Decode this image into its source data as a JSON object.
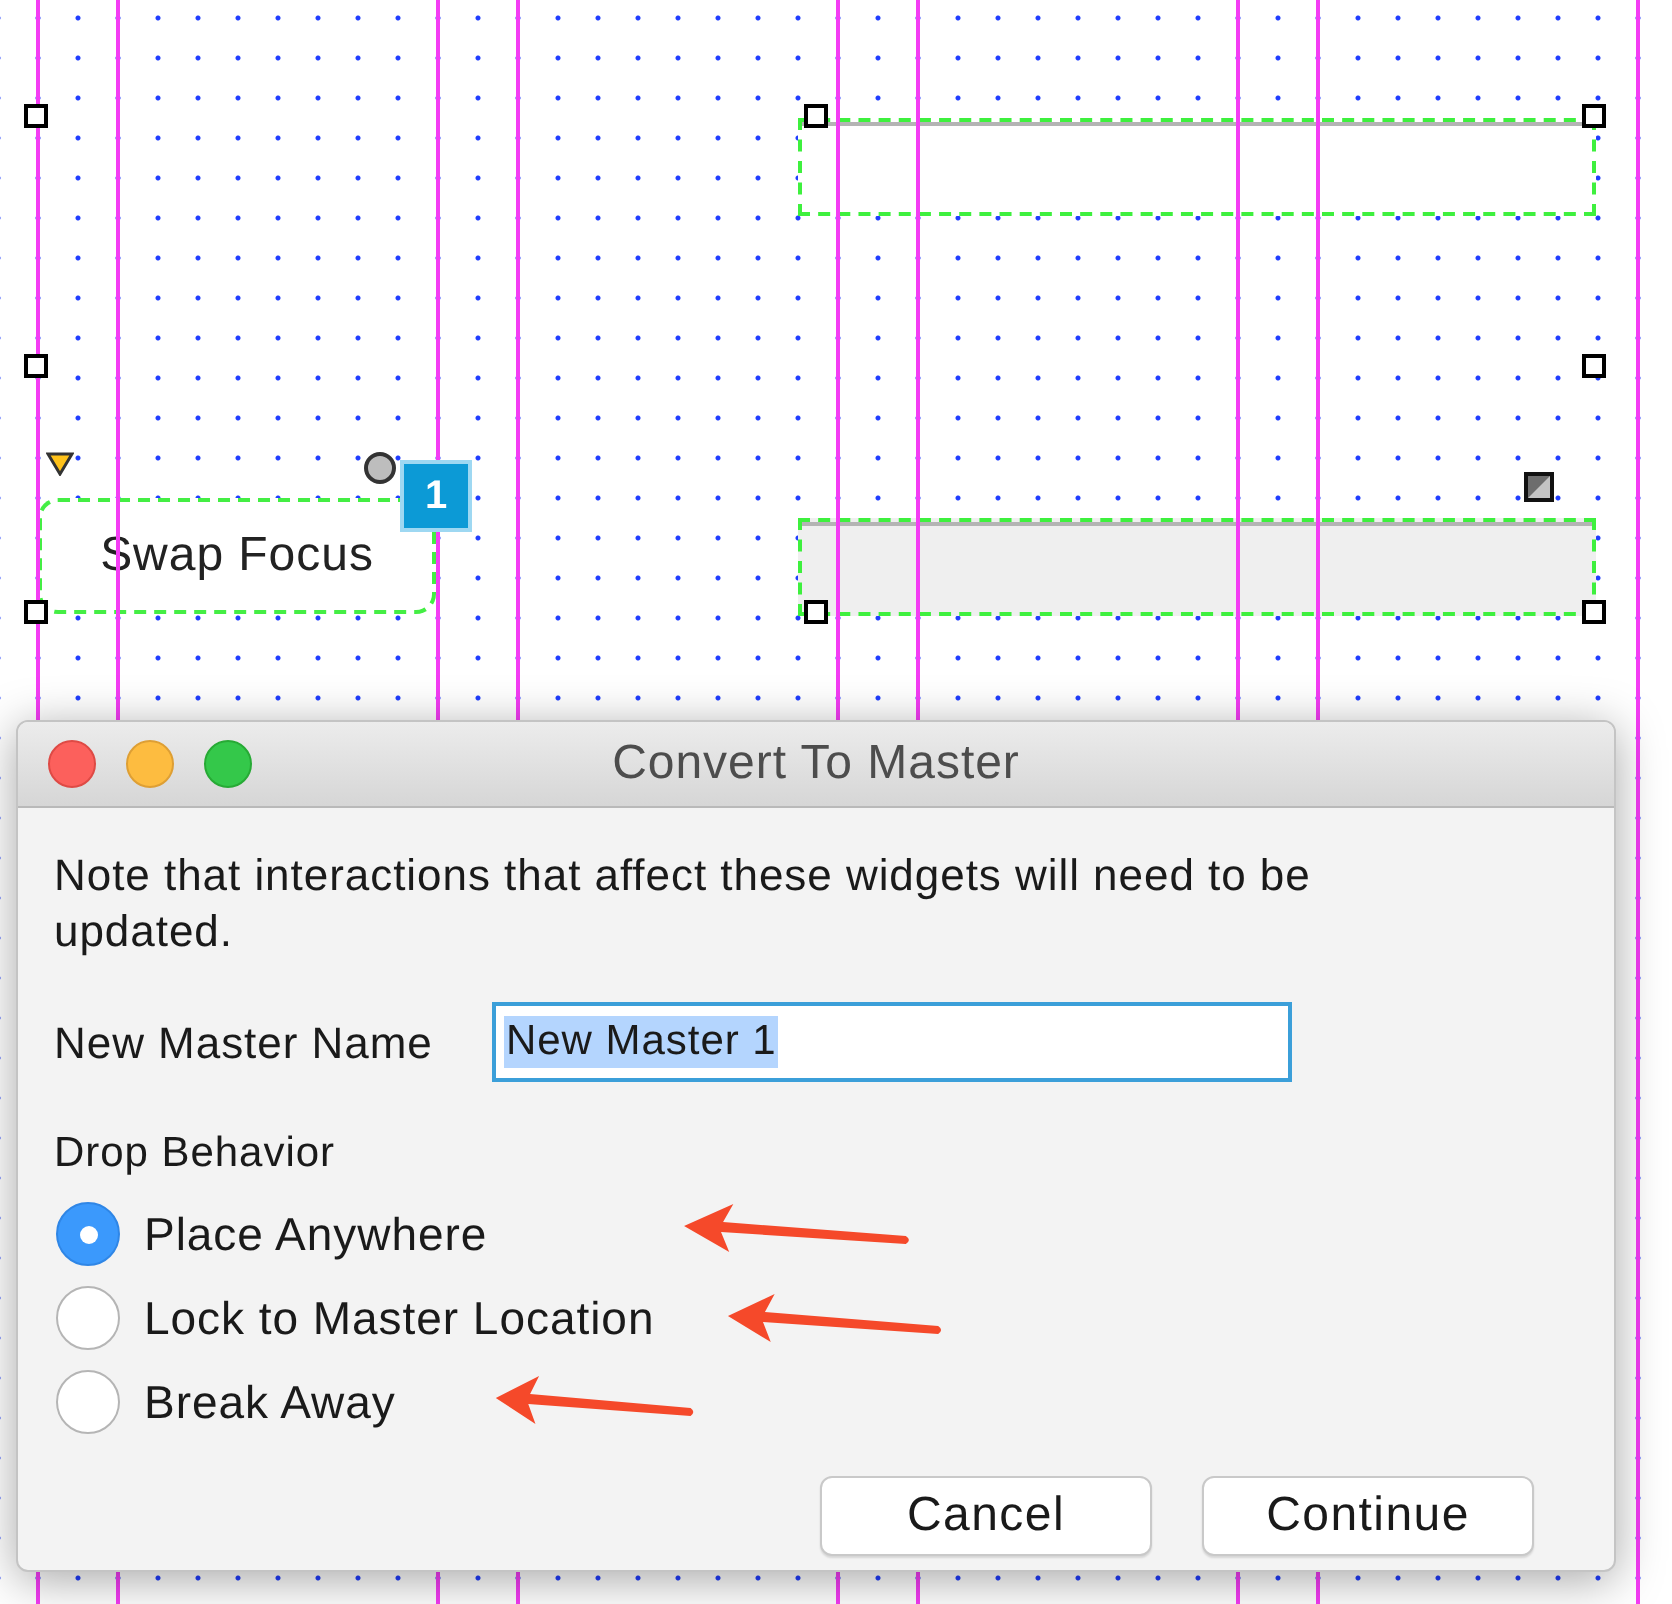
{
  "canvas": {
    "button": {
      "label": "Swap Focus",
      "badge": "1"
    }
  },
  "dialog": {
    "title": "Convert To Master",
    "message": "Note that interactions that affect these widgets will need to be updated.",
    "name_field": {
      "label": "New Master Name",
      "value": "New Master 1",
      "value_selected": true
    },
    "drop_behavior": {
      "label": "Drop Behavior",
      "options": [
        {
          "label": "Place Anywhere",
          "selected": true
        },
        {
          "label": "Lock to Master Location",
          "selected": false
        },
        {
          "label": "Break Away",
          "selected": false
        }
      ]
    },
    "buttons": [
      "Cancel",
      "Continue"
    ]
  }
}
